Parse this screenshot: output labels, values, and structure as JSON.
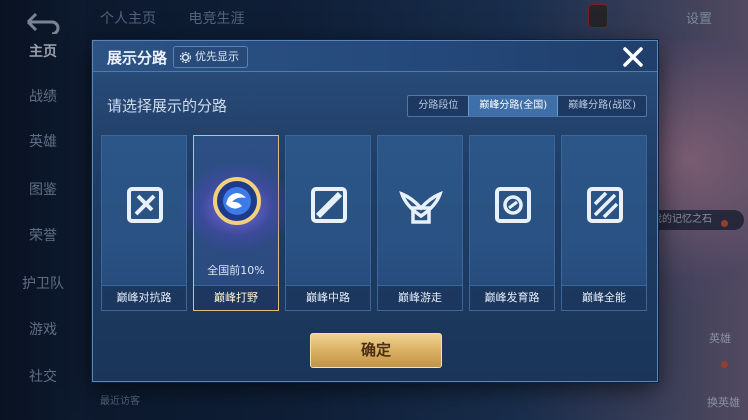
{
  "background": {
    "nav": [
      {
        "label": "主页",
        "active": true
      },
      {
        "label": "战绩",
        "active": false
      },
      {
        "label": "英雄",
        "active": false
      },
      {
        "label": "图鉴",
        "active": false
      },
      {
        "label": "荣誉",
        "active": false
      },
      {
        "label": "护卫队",
        "active": false
      },
      {
        "label": "游戏",
        "active": false
      },
      {
        "label": "社交",
        "active": false
      }
    ],
    "top_tabs": [
      "个人主页",
      "电竞生涯"
    ],
    "settings_label": "设置",
    "side_tag": "我的记忆之石",
    "recent_visitors": "最近访客",
    "hero_label_1": "英雄",
    "hero_label_2": "换英雄"
  },
  "modal": {
    "title": "展示分路",
    "priority_label": "优先显示",
    "subtitle": "请选择展示的分路",
    "segments": [
      {
        "label": "分路段位",
        "active": false
      },
      {
        "label": "巅峰分路(全国)",
        "active": true
      },
      {
        "label": "巅峰分路(战区)",
        "active": false
      }
    ],
    "cards": [
      {
        "label": "巅峰对抗路",
        "icon": "clash-lane-icon",
        "selected": false,
        "rank": ""
      },
      {
        "label": "巅峰打野",
        "icon": "jungle-icon",
        "selected": true,
        "rank": "全国前10%"
      },
      {
        "label": "巅峰中路",
        "icon": "mid-lane-icon",
        "selected": false,
        "rank": ""
      },
      {
        "label": "巅峰游走",
        "icon": "roam-icon",
        "selected": false,
        "rank": ""
      },
      {
        "label": "巅峰发育路",
        "icon": "farm-lane-icon",
        "selected": false,
        "rank": ""
      },
      {
        "label": "巅峰全能",
        "icon": "all-round-icon",
        "selected": false,
        "rank": ""
      }
    ],
    "confirm_label": "确定"
  },
  "colors": {
    "accent_gold": "#e0bc7a",
    "panel_blue": "#1f3d65"
  }
}
